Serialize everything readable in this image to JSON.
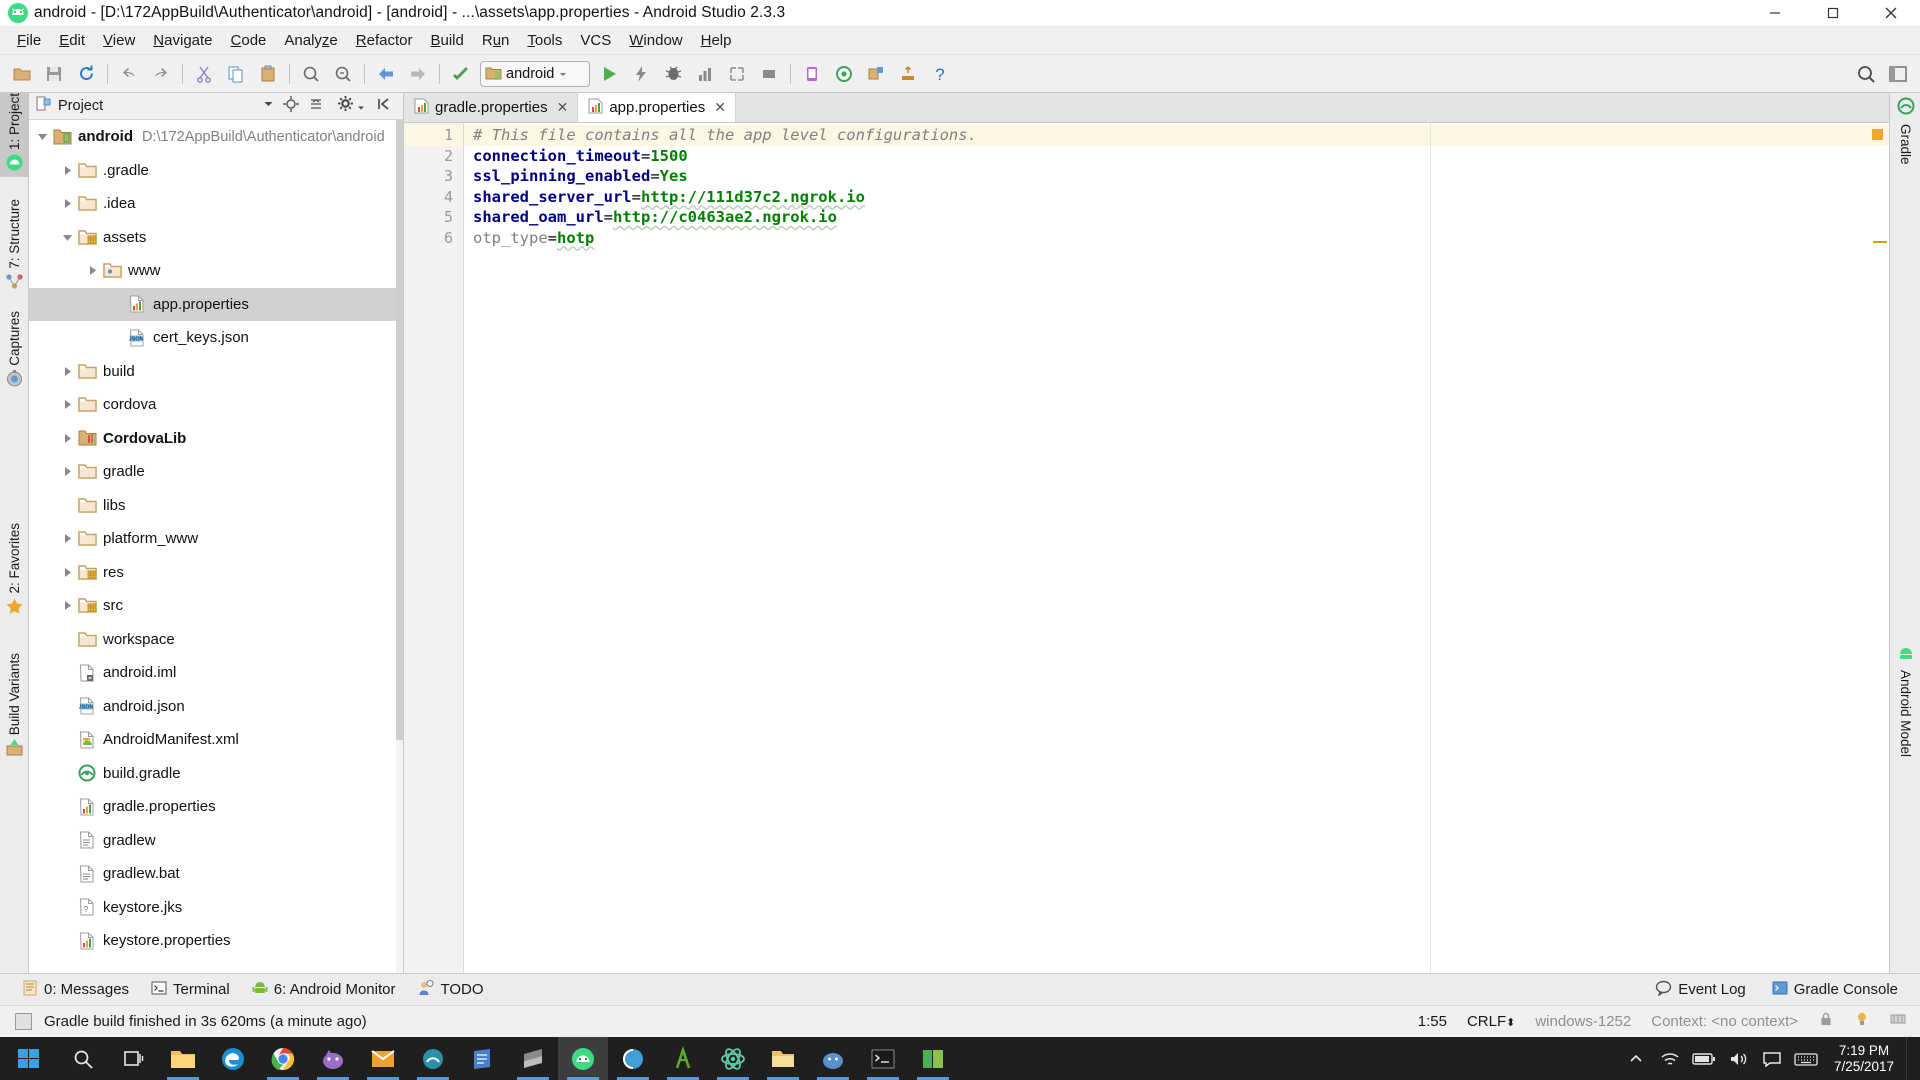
{
  "window": {
    "title": "android - [D:\\172AppBuild\\Authenticator\\android] - [android] - ...\\assets\\app.properties - Android Studio 2.3.3",
    "minimize_label": "Minimize",
    "maximize_label": "Maximize",
    "close_label": "Close"
  },
  "menu": [
    {
      "label": "File",
      "mnemonic": "F"
    },
    {
      "label": "Edit",
      "mnemonic": "E"
    },
    {
      "label": "View",
      "mnemonic": "V"
    },
    {
      "label": "Navigate",
      "mnemonic": "N"
    },
    {
      "label": "Code",
      "mnemonic": "C"
    },
    {
      "label": "Analyze",
      "mnemonic": "z"
    },
    {
      "label": "Refactor",
      "mnemonic": "R"
    },
    {
      "label": "Build",
      "mnemonic": "B"
    },
    {
      "label": "Run",
      "mnemonic": "u"
    },
    {
      "label": "Tools",
      "mnemonic": "T"
    },
    {
      "label": "VCS",
      "mnemonic": ""
    },
    {
      "label": "Window",
      "mnemonic": "W"
    },
    {
      "label": "Help",
      "mnemonic": "H"
    }
  ],
  "toolbar": {
    "icons": [
      "open-folder-icon",
      "save-all-icon",
      "sync-icon",
      "undo-icon",
      "redo-icon",
      "cut-icon",
      "copy-icon",
      "paste-icon",
      "find-icon",
      "replace-icon",
      "back-icon",
      "forward-icon",
      "make-project-icon"
    ],
    "run_config": "android",
    "run_icons": [
      "run-icon",
      "apply-changes-icon",
      "debug-icon",
      "profile-icon",
      "attach-debugger-icon",
      "stop-icon",
      "avd-manager-icon",
      "sdk-manager-icon",
      "project-structure-icon",
      "sync-gradle-icon",
      "help-icon"
    ],
    "right_icons": [
      "search-everywhere-icon",
      "layout-icon"
    ]
  },
  "left_strip": [
    {
      "label": "1: Project",
      "icon": "android-icon",
      "active": true
    },
    {
      "label": "7: Structure",
      "icon": "structure-icon",
      "active": false
    },
    {
      "label": "Captures",
      "icon": "captures-icon",
      "active": false
    },
    {
      "label": "2: Favorites",
      "icon": "star-icon",
      "active": false
    },
    {
      "label": "Build Variants",
      "icon": "build-variants-icon",
      "active": false
    }
  ],
  "right_strip": [
    {
      "label": "Gradle",
      "icon": "gradle-icon"
    },
    {
      "label": "Android Model",
      "icon": "android-model-icon"
    }
  ],
  "project": {
    "header_title": "Project",
    "header_icons": [
      "project-view-icon",
      "locate-icon",
      "collapse-all-icon",
      "settings-gear-icon",
      "hide-icon"
    ],
    "tree": [
      {
        "label": "android",
        "path": "D:\\172AppBuild\\Authenticator\\android",
        "icon": "module-icon",
        "indent": 0,
        "arrow": "down",
        "bold": true,
        "selected": false
      },
      {
        "label": ".gradle",
        "path": "",
        "icon": "folder-icon",
        "indent": 1,
        "arrow": "right",
        "bold": false,
        "selected": false
      },
      {
        "label": ".idea",
        "path": "",
        "icon": "folder-icon",
        "indent": 1,
        "arrow": "right",
        "bold": false,
        "selected": false
      },
      {
        "label": "assets",
        "path": "",
        "icon": "folder-resource-icon",
        "indent": 1,
        "arrow": "down",
        "bold": false,
        "selected": false
      },
      {
        "label": "www",
        "path": "",
        "icon": "folder-web-icon",
        "indent": 2,
        "arrow": "right",
        "bold": false,
        "selected": false
      },
      {
        "label": "app.properties",
        "path": "",
        "icon": "properties-file-icon",
        "indent": 3,
        "arrow": "none",
        "bold": false,
        "selected": true
      },
      {
        "label": "cert_keys.json",
        "path": "",
        "icon": "json-file-icon",
        "indent": 3,
        "arrow": "none",
        "bold": false,
        "selected": false
      },
      {
        "label": "build",
        "path": "",
        "icon": "folder-icon",
        "indent": 1,
        "arrow": "right",
        "bold": false,
        "selected": false
      },
      {
        "label": "cordova",
        "path": "",
        "icon": "folder-icon",
        "indent": 1,
        "arrow": "right",
        "bold": false,
        "selected": false
      },
      {
        "label": "CordovaLib",
        "path": "",
        "icon": "library-module-icon",
        "indent": 1,
        "arrow": "right",
        "bold": true,
        "selected": false
      },
      {
        "label": "gradle",
        "path": "",
        "icon": "folder-icon",
        "indent": 1,
        "arrow": "right",
        "bold": false,
        "selected": false
      },
      {
        "label": "libs",
        "path": "",
        "icon": "folder-icon",
        "indent": 1,
        "arrow": "none",
        "bold": false,
        "selected": false
      },
      {
        "label": "platform_www",
        "path": "",
        "icon": "folder-icon",
        "indent": 1,
        "arrow": "right",
        "bold": false,
        "selected": false
      },
      {
        "label": "res",
        "path": "",
        "icon": "folder-resource-icon",
        "indent": 1,
        "arrow": "right",
        "bold": false,
        "selected": false
      },
      {
        "label": "src",
        "path": "",
        "icon": "folder-resource-icon",
        "indent": 1,
        "arrow": "right",
        "bold": false,
        "selected": false
      },
      {
        "label": "workspace",
        "path": "",
        "icon": "folder-icon",
        "indent": 1,
        "arrow": "none",
        "bold": false,
        "selected": false
      },
      {
        "label": "android.iml",
        "path": "",
        "icon": "iml-file-icon",
        "indent": 1,
        "arrow": "none",
        "bold": false,
        "selected": false
      },
      {
        "label": "android.json",
        "path": "",
        "icon": "json-file-icon",
        "indent": 1,
        "arrow": "none",
        "bold": false,
        "selected": false
      },
      {
        "label": "AndroidManifest.xml",
        "path": "",
        "icon": "manifest-file-icon",
        "indent": 1,
        "arrow": "none",
        "bold": false,
        "selected": false
      },
      {
        "label": "build.gradle",
        "path": "",
        "icon": "gradle-file-icon",
        "indent": 1,
        "arrow": "none",
        "bold": false,
        "selected": false
      },
      {
        "label": "gradle.properties",
        "path": "",
        "icon": "properties-file-icon",
        "indent": 1,
        "arrow": "none",
        "bold": false,
        "selected": false
      },
      {
        "label": "gradlew",
        "path": "",
        "icon": "text-file-icon",
        "indent": 1,
        "arrow": "none",
        "bold": false,
        "selected": false
      },
      {
        "label": "gradlew.bat",
        "path": "",
        "icon": "text-file-icon",
        "indent": 1,
        "arrow": "none",
        "bold": false,
        "selected": false
      },
      {
        "label": "keystore.jks",
        "path": "",
        "icon": "unknown-file-icon",
        "indent": 1,
        "arrow": "none",
        "bold": false,
        "selected": false
      },
      {
        "label": "keystore.properties",
        "path": "",
        "icon": "properties-file-icon",
        "indent": 1,
        "arrow": "none",
        "bold": false,
        "selected": false
      }
    ]
  },
  "editor": {
    "tabs": [
      {
        "label": "gradle.properties",
        "icon": "properties-file-icon",
        "active": false
      },
      {
        "label": "app.properties",
        "icon": "properties-file-icon",
        "active": true
      }
    ],
    "lines": [
      {
        "n": "1",
        "highlight": true,
        "parts": [
          {
            "t": "# This file contains all the app level configurations.",
            "c": "c-comment"
          }
        ]
      },
      {
        "n": "2",
        "highlight": false,
        "parts": [
          {
            "t": "connection_timeout",
            "c": "c-key"
          },
          {
            "t": "=",
            "c": "c-eq"
          },
          {
            "t": "1500",
            "c": "c-val"
          }
        ]
      },
      {
        "n": "3",
        "highlight": false,
        "parts": [
          {
            "t": "ssl_pinning_enabled",
            "c": "c-key"
          },
          {
            "t": "=",
            "c": "c-eq"
          },
          {
            "t": "Yes",
            "c": "c-val"
          }
        ]
      },
      {
        "n": "4",
        "highlight": false,
        "parts": [
          {
            "t": "shared_server_url",
            "c": "c-key"
          },
          {
            "t": "=",
            "c": "c-eq"
          },
          {
            "t": "http://111d37c2.ngrok.io",
            "c": "c-val-u"
          }
        ]
      },
      {
        "n": "5",
        "highlight": false,
        "parts": [
          {
            "t": "shared_oam_url",
            "c": "c-key"
          },
          {
            "t": "=",
            "c": "c-eq"
          },
          {
            "t": "http://c0463ae2.ngrok.io",
            "c": "c-val-u"
          }
        ]
      },
      {
        "n": "6",
        "highlight": false,
        "parts": [
          {
            "t": "otp_type",
            "c": "c-key-plain"
          },
          {
            "t": "=",
            "c": "c-eq"
          },
          {
            "t": "hotp",
            "c": "c-val-u"
          }
        ]
      }
    ]
  },
  "bottom_bar": {
    "items": [
      {
        "label": "0: Messages",
        "icon": "messages-icon"
      },
      {
        "label": "Terminal",
        "icon": "terminal-icon"
      },
      {
        "label": "6: Android Monitor",
        "icon": "android-monitor-icon"
      },
      {
        "label": "TODO",
        "icon": "todo-icon"
      }
    ],
    "right_items": [
      {
        "label": "Event Log",
        "icon": "event-log-icon"
      },
      {
        "label": "Gradle Console",
        "icon": "gradle-console-icon"
      }
    ]
  },
  "status_bar": {
    "message": "Gradle build finished in 3s 620ms (a minute ago)",
    "caret_position": "1:55",
    "line_separator": "CRLF",
    "encoding": "windows-1252",
    "context": "Context: <no context>",
    "right_icons": [
      "lock-icon",
      "inspection-icon",
      "memory-icon"
    ]
  },
  "taskbar": {
    "start_label": "Start",
    "items": [
      {
        "icon": "search-icon",
        "running": false,
        "active": false
      },
      {
        "icon": "task-view-icon",
        "running": false,
        "active": false
      },
      {
        "icon": "file-explorer-icon",
        "running": true,
        "active": false
      },
      {
        "icon": "edge-icon",
        "running": false,
        "active": false
      },
      {
        "icon": "chrome-icon",
        "running": true,
        "active": false
      },
      {
        "icon": "app-purple-icon",
        "running": true,
        "active": false
      },
      {
        "icon": "outlook-icon",
        "running": true,
        "active": false
      },
      {
        "icon": "app-teal-icon",
        "running": true,
        "active": false
      },
      {
        "icon": "notes-icon",
        "running": false,
        "active": false
      },
      {
        "icon": "sublime-icon",
        "running": true,
        "active": false
      },
      {
        "icon": "android-studio-icon",
        "running": true,
        "active": true
      },
      {
        "icon": "app-circle-icon",
        "running": true,
        "active": false
      },
      {
        "icon": "lambda-icon",
        "running": true,
        "active": false
      },
      {
        "icon": "atom-icon",
        "running": true,
        "active": false
      },
      {
        "icon": "folder-yellow-icon",
        "running": true,
        "active": false
      },
      {
        "icon": "app-blue-icon",
        "running": true,
        "active": false
      },
      {
        "icon": "console-icon",
        "running": true,
        "active": false
      },
      {
        "icon": "app-green-icon",
        "running": true,
        "active": false
      }
    ],
    "tray_icons": [
      "show-hidden-icon",
      "network-icon",
      "battery-icon",
      "volume-icon",
      "action-center-icon",
      "keyboard-icon"
    ],
    "clock_time": "7:19 PM",
    "clock_date": "7/25/2017"
  }
}
